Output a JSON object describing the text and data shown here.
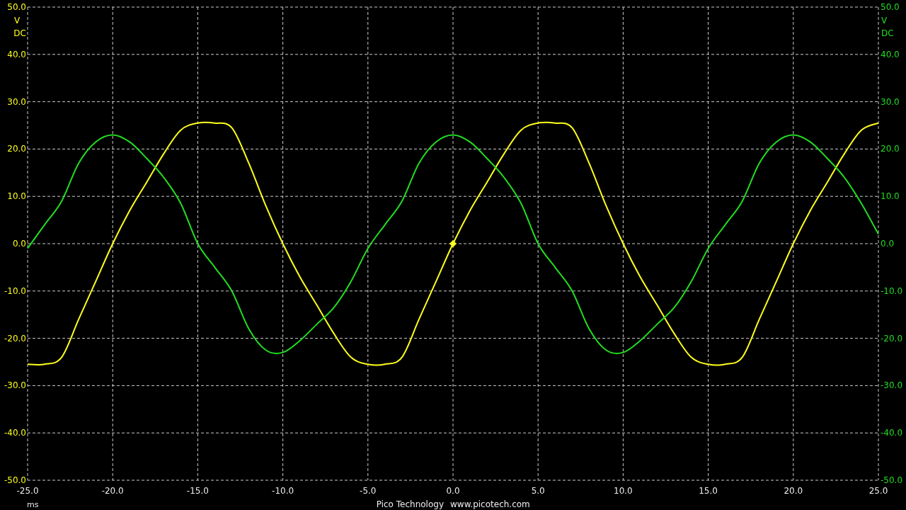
{
  "chart_data": {
    "type": "line",
    "xlabel": "ms",
    "xlim": [
      -25,
      25
    ],
    "ylim": [
      -50,
      50
    ],
    "x": [
      -25,
      -24,
      -23,
      -22,
      -21,
      -20,
      -19,
      -18,
      -17,
      -16,
      -15,
      -14,
      -13,
      -12,
      -11,
      -10,
      -9,
      -8,
      -7,
      -6,
      -5,
      -4,
      -3,
      -2,
      -1,
      0,
      1,
      2,
      3,
      4,
      5,
      6,
      7,
      8,
      9,
      10,
      11,
      12,
      13,
      14,
      15,
      16,
      17,
      18,
      19,
      20,
      21,
      22,
      23,
      24,
      25
    ],
    "series": [
      {
        "color": "#ffff1e",
        "values": [
          -25.5,
          -25.5,
          -24,
          -16,
          -8,
          0,
          7,
          13,
          19,
          24,
          25.5,
          25.5,
          24.5,
          17,
          8,
          0,
          -7,
          -13,
          -19,
          -24,
          -25.5,
          -25.5,
          -24,
          -16,
          -8,
          0,
          7,
          13,
          19,
          24,
          25.5,
          25.5,
          24.5,
          17,
          8,
          0,
          -7,
          -13,
          -19,
          -24,
          -25.5,
          -25.5,
          -24,
          -16,
          -8,
          0,
          7,
          13,
          19,
          24,
          25.5
        ]
      },
      {
        "color": "#22dd22",
        "values": [
          -1,
          4,
          9,
          17,
          21.5,
          23,
          21.5,
          18,
          14,
          8.5,
          0,
          -5,
          -10,
          -18,
          -22.5,
          -23,
          -20.5,
          -17,
          -13.5,
          -8,
          -1,
          4,
          9,
          17,
          21.5,
          23,
          21.5,
          18,
          14,
          8.5,
          0,
          -5,
          -10,
          -18,
          -22.5,
          -23,
          -20.5,
          -17,
          -13.5,
          -8,
          -1,
          4,
          9,
          17,
          21.5,
          23,
          21.5,
          18,
          14,
          8.5,
          2
        ]
      }
    ],
    "xticks": [
      {
        "value": -25,
        "label": "-25.0"
      },
      {
        "value": -20,
        "label": "-20.0"
      },
      {
        "value": -15,
        "label": "-15.0"
      },
      {
        "value": -10,
        "label": "-10.0"
      },
      {
        "value": -5,
        "label": "-5.0"
      },
      {
        "value": 0,
        "label": "0.0"
      },
      {
        "value": 5,
        "label": "5.0"
      },
      {
        "value": 10,
        "label": "10.0"
      },
      {
        "value": 15,
        "label": "15.0"
      },
      {
        "value": 20,
        "label": "20.0"
      },
      {
        "value": 25,
        "label": "25.0"
      }
    ],
    "yticks": [
      {
        "value": 50,
        "label": "50.0"
      },
      {
        "value": 40,
        "label": "40.0"
      },
      {
        "value": 30,
        "label": "30.0"
      },
      {
        "value": 20,
        "label": "20.0"
      },
      {
        "value": 10,
        "label": "10.0"
      },
      {
        "value": 0,
        "label": "0.0"
      },
      {
        "value": -10,
        "label": "-10.0"
      },
      {
        "value": -20,
        "label": "-20.0"
      },
      {
        "value": -30,
        "label": "-30.0"
      },
      {
        "value": -40,
        "label": "-40.0"
      },
      {
        "value": -50,
        "label": "-50.0"
      }
    ],
    "grid": true
  },
  "trigger_marker": true,
  "left_axis": {
    "unit": "V",
    "coupling": "DC"
  },
  "right_axis": {
    "unit": "V",
    "coupling": "DC",
    "tick_labels": [
      "50.0",
      "40.0",
      "30.0",
      "20.0",
      "10.0",
      "0.0",
      "-10.0",
      "-20.0",
      "-30.0",
      "-40.0",
      "-50.0"
    ]
  },
  "footer": {
    "company": "Pico Technology",
    "website": "www.picotech.com"
  }
}
